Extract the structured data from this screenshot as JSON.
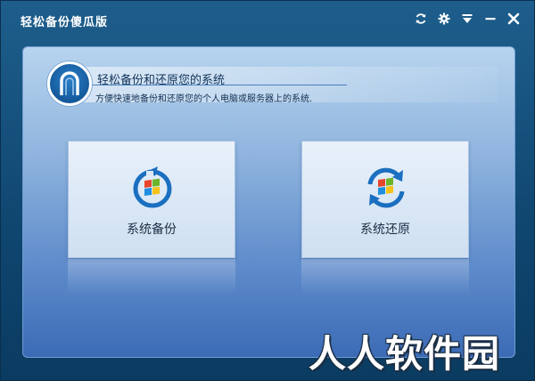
{
  "window": {
    "title": "轻松备份傻瓜版",
    "controls": [
      "refresh-icon",
      "gear-icon",
      "menu-icon",
      "minimize-icon",
      "close-icon"
    ]
  },
  "banner": {
    "title": "轻松备份和还原您的系统",
    "subtitle": "方便快速地备份和还原您的个人电脑或服务器上的系统."
  },
  "actions": {
    "backup_label": "系统备份",
    "restore_label": "系统还原"
  },
  "watermark": "人人软件园",
  "colors": {
    "title_bar": "#1e5e8c",
    "panel_top": "#b7d4ee",
    "panel_bottom": "#3c6bb6",
    "icon_blue": "#1a6fc0",
    "win_red": "#e8452c",
    "win_green": "#6bb52a",
    "win_blue": "#1f8fe0",
    "win_yellow": "#f5c21a"
  }
}
